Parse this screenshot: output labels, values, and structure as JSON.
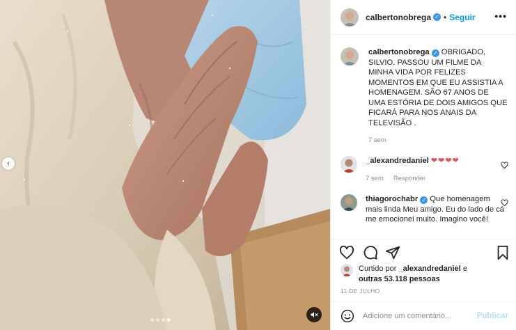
{
  "post": {
    "author": "calbertonobrega",
    "separator": "•",
    "follow_label": "Seguir",
    "more_label": "•••",
    "caption": {
      "author": "calbertonobrega",
      "text": "OBRIGADO, SILVIO. PASSOU UM FILME DA MINHA VIDA POR FELIZES MOMENTOS EM QUE EU ASSISTIA A HOMENAGEM. SÃO 67 ANOS DE UMA ESTÓRIA DE DOIS AMIGOS QUE FICARÁ PARA NOS ANAIS DA TELEVISÃO .",
      "time": "7 sem"
    },
    "comments": [
      {
        "author": "_alexandredaniel",
        "text": "❤❤❤❤",
        "time": "7 sem",
        "reply_label": "Responder",
        "verified": false
      },
      {
        "author": "thiagorochabr",
        "text": "Que homenagem mais linda Meu amigo. Eu do lado de cá me emocionei muito. Imagino você!",
        "verified": true
      }
    ],
    "likes": {
      "prefix": "Curtido por",
      "user": "_alexandredaniel",
      "middle": "e",
      "others": "outras 53.118 pessoas"
    },
    "date": "11 DE JULHO",
    "add_comment_placeholder": "Adicione um comentário...",
    "publish_label": "Publicar"
  },
  "media": {
    "prev_arrow": "‹",
    "carousel_dots": 4,
    "active_dot": 3
  },
  "colors": {
    "accent": "#0095f6",
    "verified": "#3897f0",
    "heart": "#ed4956",
    "muted_text": "#8e8e8e",
    "publish_disabled": "#b2dffc"
  }
}
